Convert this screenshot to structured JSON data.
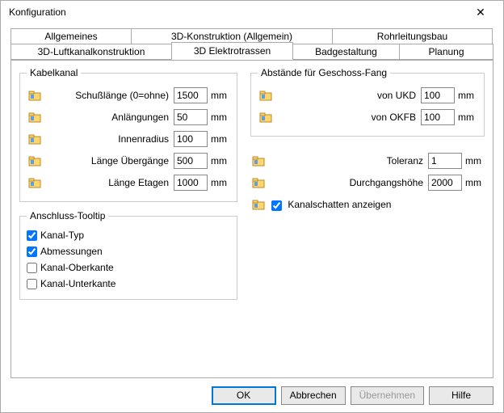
{
  "window": {
    "title": "Konfiguration"
  },
  "tabs": {
    "row1": {
      "t1": "Allgemeines",
      "t2": "3D-Konstruktion (Allgemein)",
      "t3": "Rohrleitungsbau"
    },
    "row2": {
      "t1": "3D-Luftkanalkonstruktion",
      "t2": "3D Elektrotrassen",
      "t3": "Badgestaltung",
      "t4": "Planung"
    }
  },
  "group_kabelkanal": {
    "legend": "Kabelkanal",
    "rows": {
      "schusslaenge": {
        "label": "Schußlänge (0=ohne)",
        "value": "1500",
        "unit": "mm"
      },
      "anlaengungen": {
        "label": "Anlängungen",
        "value": "50",
        "unit": "mm"
      },
      "innenradius": {
        "label": "Innenradius",
        "value": "100",
        "unit": "mm"
      },
      "uebergaenge": {
        "label": "Länge Übergänge",
        "value": "500",
        "unit": "mm"
      },
      "etagen": {
        "label": "Länge Etagen",
        "value": "1000",
        "unit": "mm"
      }
    }
  },
  "group_abstaende": {
    "legend": "Abstände für Geschoss-Fang",
    "rows": {
      "ukd": {
        "label": "von UKD",
        "value": "100",
        "unit": "mm"
      },
      "okfb": {
        "label": "von OKFB",
        "value": "100",
        "unit": "mm"
      }
    }
  },
  "free": {
    "toleranz": {
      "label": "Toleranz",
      "value": "1",
      "unit": "mm"
    },
    "durchgangshoehe": {
      "label": "Durchgangshöhe",
      "value": "2000",
      "unit": "mm"
    },
    "kanalschatten": {
      "label": "Kanalschatten anzeigen",
      "checked": true
    }
  },
  "group_tooltip": {
    "legend": "Anschluss-Tooltip",
    "items": {
      "kanaltyp": {
        "label": "Kanal-Typ",
        "checked": true
      },
      "abmess": {
        "label": "Abmessungen",
        "checked": true
      },
      "oberkante": {
        "label": "Kanal-Oberkante",
        "checked": false
      },
      "unterkante": {
        "label": "Kanal-Unterkante",
        "checked": false
      }
    }
  },
  "buttons": {
    "ok": "OK",
    "cancel": "Abbrechen",
    "apply": "Übernehmen",
    "help": "Hilfe"
  }
}
